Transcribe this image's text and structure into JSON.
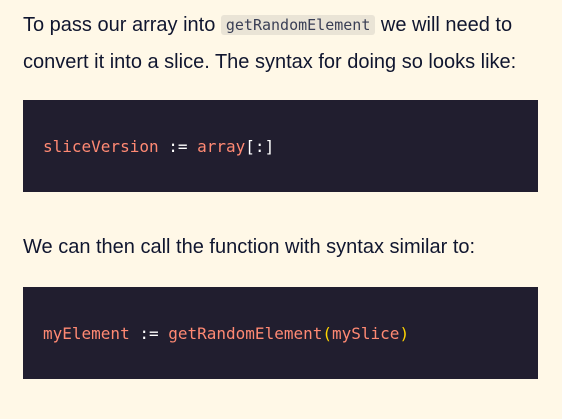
{
  "paragraph1": {
    "before": "To pass our array into ",
    "code": "getRandomElement",
    "after": " we will need to convert it into a slice. The syntax for doing so looks like:"
  },
  "code_block1": {
    "var": "sliceVersion",
    "op": " := ",
    "value": "array",
    "slice": "[:]"
  },
  "paragraph2": {
    "text": "We can then call the function with syntax similar to:"
  },
  "code_block2": {
    "var": "myElement",
    "op": " := ",
    "fn": "getRandomElement",
    "open_paren": "(",
    "arg": "mySlice",
    "close_paren": ")"
  },
  "colors": {
    "background": "#fff8e7",
    "text": "#10162f",
    "code_background": "#211e2f",
    "code_identifier": "#ff8973",
    "code_operator": "#ffffff",
    "code_paren": "#ffd400",
    "inline_code_background": "#eae4d6"
  }
}
